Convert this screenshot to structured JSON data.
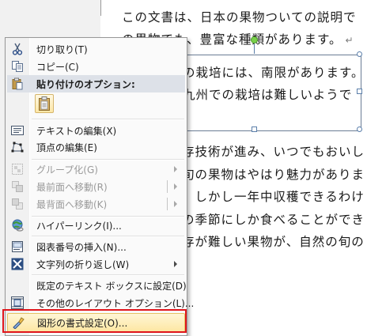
{
  "document": {
    "lines": [
      "この文書は、日本の果物ついての説明で",
      "の果物でも、豊富な種類があります。",
      "存技術が進み、いつでもおいし",
      "旬の果物はやはり魅力がありま",
      "。しかし一年中収穫できるわけ",
      "の季節にしか食べることができ",
      "存が難しい果物が、自然の旬の"
    ],
    "paragraph_mark": "↵",
    "textbox_lines": [
      "の栽培には、南限があります。",
      "九州での栽培は難しいようで"
    ]
  },
  "menu": {
    "items": [
      {
        "id": "cut",
        "label": "切り取り(T)",
        "icon": "scissors-icon",
        "enabled": true
      },
      {
        "id": "copy",
        "label": "コピー(C)",
        "icon": "copy-icon",
        "enabled": true
      },
      {
        "id": "paste_options",
        "label": "貼り付けのオプション:",
        "icon": "paste-icon",
        "enabled": true
      },
      {
        "id": "edit_text",
        "label": "テキストの編集(X)",
        "icon": "edit-text-icon",
        "enabled": true
      },
      {
        "id": "edit_points",
        "label": "頂点の編集(E)",
        "icon": "edit-points-icon",
        "enabled": true
      },
      {
        "id": "group",
        "label": "グループ化(G)",
        "icon": "group-icon",
        "enabled": false
      },
      {
        "id": "bring_front",
        "label": "最前面へ移動(R)",
        "icon": "bring-front-icon",
        "enabled": false
      },
      {
        "id": "send_back",
        "label": "最背面へ移動(K)",
        "icon": "send-back-icon",
        "enabled": false
      },
      {
        "id": "hyperlink",
        "label": "ハイパーリンク(I)...",
        "icon": "hyperlink-icon",
        "enabled": true
      },
      {
        "id": "insert_caption",
        "label": "図表番号の挿入(N)...",
        "icon": "caption-icon",
        "enabled": true
      },
      {
        "id": "wrap_text",
        "label": "文字列の折り返し(W)",
        "icon": "wrap-text-icon",
        "enabled": true
      },
      {
        "id": "set_default",
        "label": "既定のテキスト ボックスに設定(D)",
        "icon": "",
        "enabled": true
      },
      {
        "id": "more_layout",
        "label": "その他のレイアウト オプション(L)...",
        "icon": "layout-options-icon",
        "enabled": true
      },
      {
        "id": "format_shape",
        "label": "図形の書式設定(O)...",
        "icon": "format-shape-icon",
        "enabled": true
      }
    ],
    "highlight_color": "#e0161c"
  }
}
